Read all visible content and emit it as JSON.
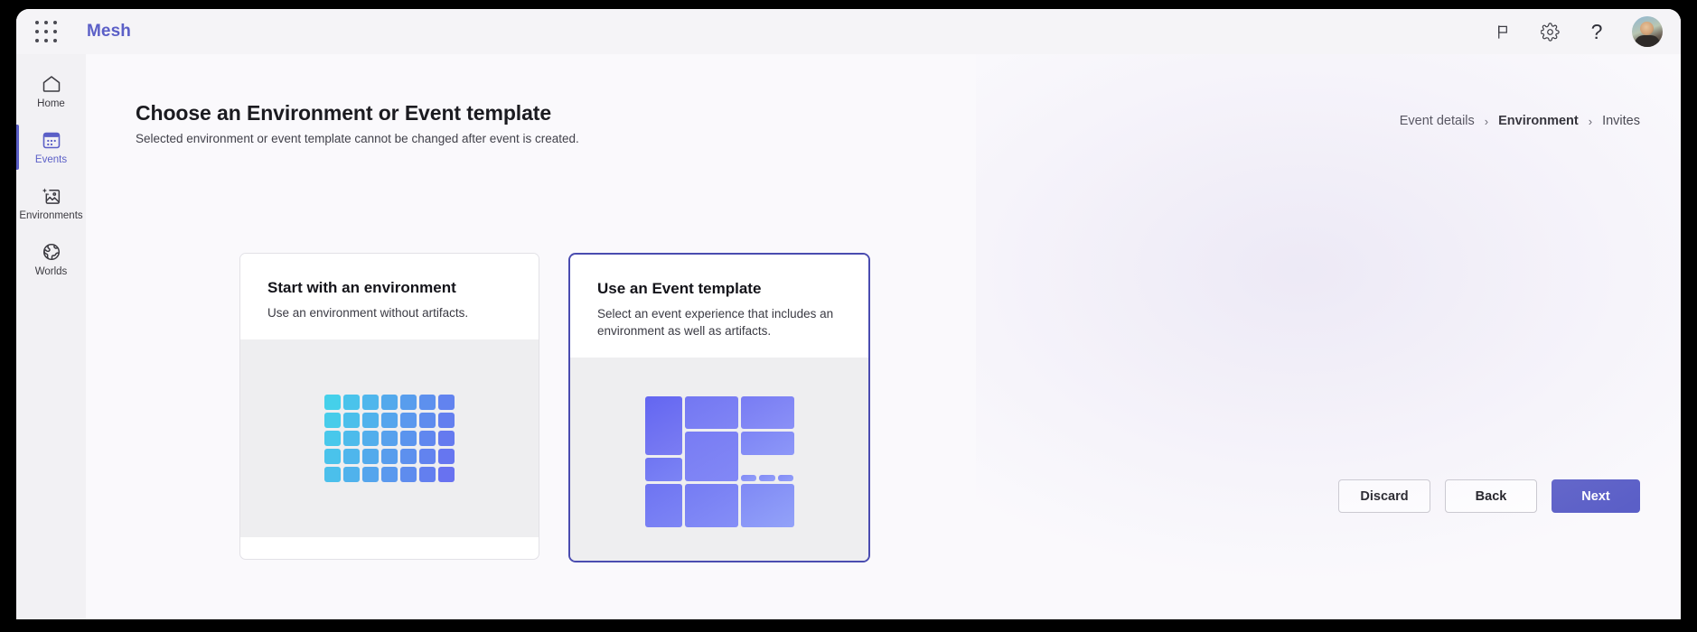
{
  "app": {
    "brand": "Mesh"
  },
  "topbar": {
    "waffle_name": "app-launcher",
    "icons": [
      {
        "name": "flag-icon",
        "label": "Flag"
      },
      {
        "name": "gear-icon",
        "label": "Settings"
      },
      {
        "name": "help-icon",
        "label": "?"
      }
    ],
    "help_glyph": "?",
    "avatar_label": "User profile"
  },
  "sidebar": {
    "items": [
      {
        "label": "Home",
        "icon": "home-icon",
        "active": false
      },
      {
        "label": "Events",
        "icon": "calendar-icon",
        "active": true
      },
      {
        "label": "Environments",
        "icon": "image-sparkle-icon",
        "active": false
      },
      {
        "label": "Worlds",
        "icon": "globe-icon",
        "active": false
      }
    ]
  },
  "page": {
    "title": "Choose an Environment or Event template",
    "subtitle": "Selected environment or event template cannot be changed after event is created."
  },
  "breadcrumb": {
    "separator": "›",
    "items": [
      {
        "label": "Event details",
        "current": false
      },
      {
        "label": "Environment",
        "current": true
      },
      {
        "label": "Invites",
        "current": false
      }
    ]
  },
  "cards": [
    {
      "title": "Start with an environment",
      "description": "Use an environment without artifacts.",
      "selected": false,
      "illustration": "grid-tiles"
    },
    {
      "title": "Use an Event template",
      "description": "Select an event experience that includes an environment as well as artifacts.",
      "selected": true,
      "illustration": "mosaic-tiles"
    }
  ],
  "footer": {
    "discard_label": "Discard",
    "back_label": "Back",
    "next_label": "Next"
  },
  "colors": {
    "accent": "#5b5fc7",
    "selected_border": "#4a4cb0",
    "page_bg": "#faf9fc",
    "sidebar_bg": "#f2f1f4",
    "illustration_bg": "#eeeef0",
    "grid_start": "#45d0ea",
    "grid_end": "#6872f0"
  }
}
